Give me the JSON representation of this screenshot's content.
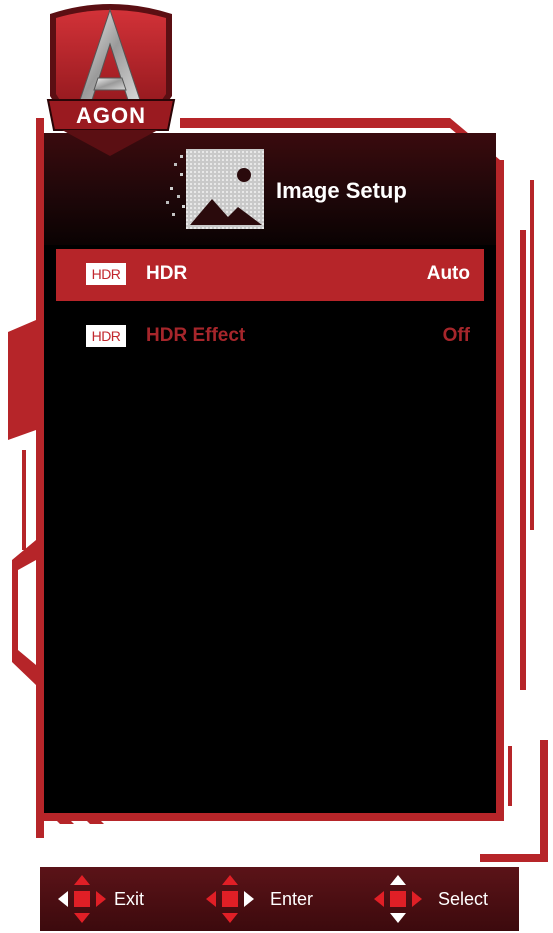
{
  "logo": {
    "text": "AGON"
  },
  "header": {
    "title": "Image Setup",
    "icon": "image-setup-icon"
  },
  "menu": {
    "items": [
      {
        "icon_text": "HDR",
        "label": "HDR",
        "value": "Auto",
        "state": "selected"
      },
      {
        "icon_text": "HDR",
        "label": "HDR Effect",
        "value": "Off",
        "state": "disabled"
      }
    ]
  },
  "nav": {
    "exit_label": "Exit",
    "enter_label": "Enter",
    "select_label": "Select"
  },
  "colors": {
    "accent": "#b62529",
    "panel": "#000000",
    "disabled_text": "#a6262b"
  }
}
